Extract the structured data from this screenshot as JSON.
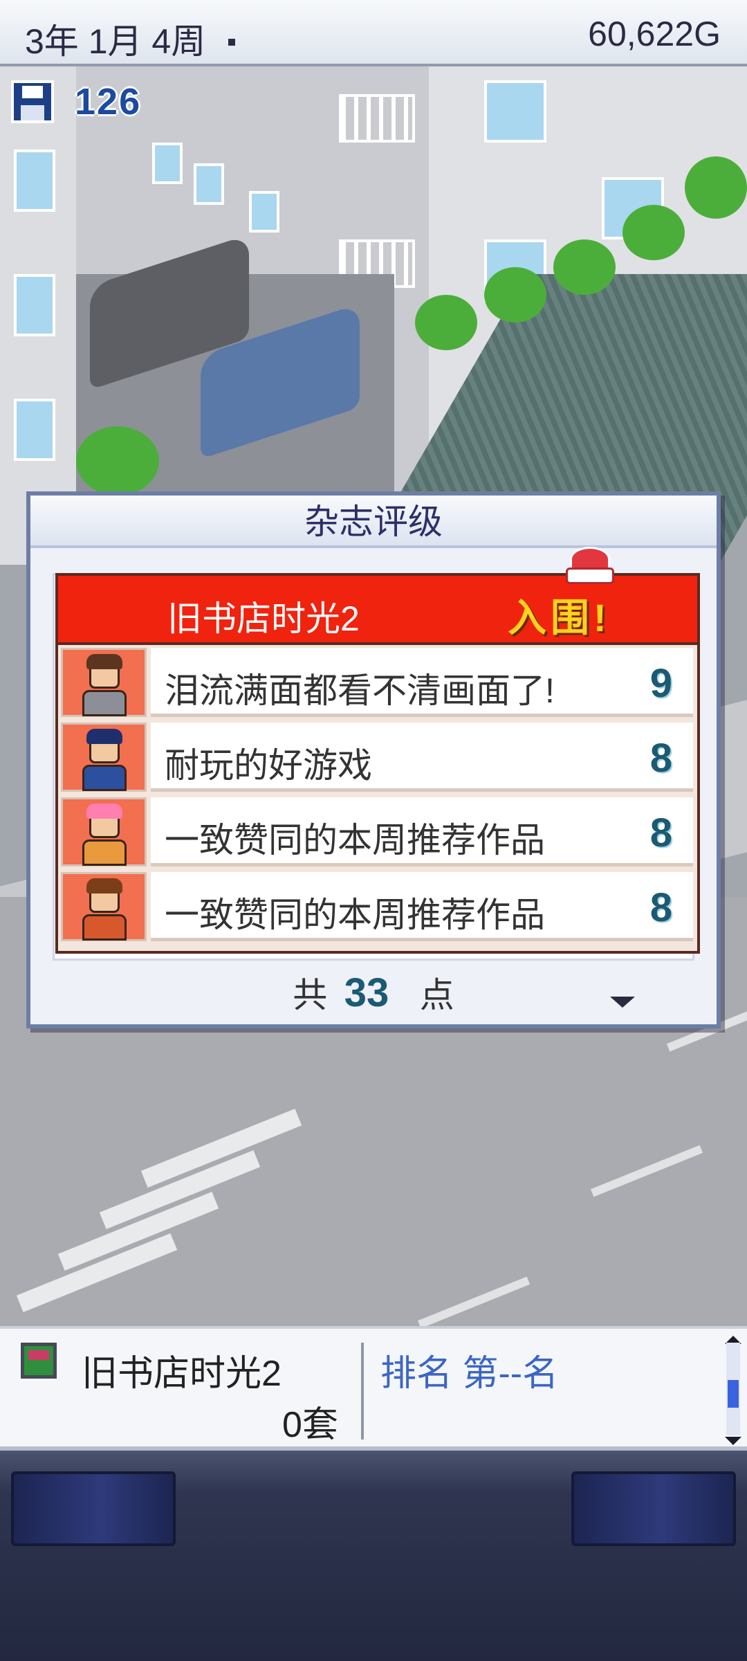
{
  "status_bar": {
    "date": "3年 1月 4周",
    "money": "60,622G"
  },
  "save_indicator": {
    "icon": "floppy-disk-icon",
    "count": "126"
  },
  "dialog": {
    "title": "杂志评级",
    "game_name": "旧书店时光2",
    "nominated_label": "入围!",
    "reviews": [
      {
        "reviewer": "reviewer-1",
        "comment": "泪流满面都看不清画面了!",
        "score": "9"
      },
      {
        "reviewer": "reviewer-2",
        "comment": "耐玩的好游戏",
        "score": "8"
      },
      {
        "reviewer": "reviewer-3",
        "comment": "一致赞同的本周推荐作品",
        "score": "8"
      },
      {
        "reviewer": "reviewer-4",
        "comment": "一致赞同的本周推荐作品",
        "score": "8"
      }
    ],
    "total_prefix": "共",
    "total_value": "33",
    "total_suffix": "点"
  },
  "info_panel": {
    "game_title": "旧书店时光2",
    "sales": "0套",
    "rank": "排名 第--名"
  },
  "colors": {
    "banner_red": "#f0230f",
    "nominated_gold": "#ffd21c",
    "score_teal": "#1b5a72",
    "rank_blue": "#3b66c4"
  }
}
